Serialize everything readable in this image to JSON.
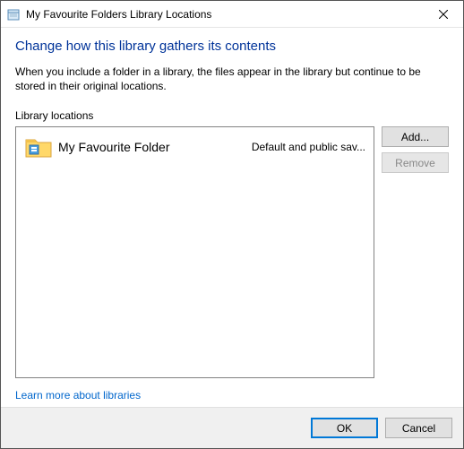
{
  "titlebar": {
    "title": "My Favourite Folders Library Locations"
  },
  "heading": "Change how this library gathers its contents",
  "description": "When you include a folder in a library, the files appear in the library but continue to be stored in their original locations.",
  "section_label": "Library locations",
  "locations": [
    {
      "name": "My Favourite Folder",
      "detail": "Default and public sav..."
    }
  ],
  "buttons": {
    "add": "Add...",
    "remove": "Remove",
    "ok": "OK",
    "cancel": "Cancel"
  },
  "link": "Learn more about libraries"
}
